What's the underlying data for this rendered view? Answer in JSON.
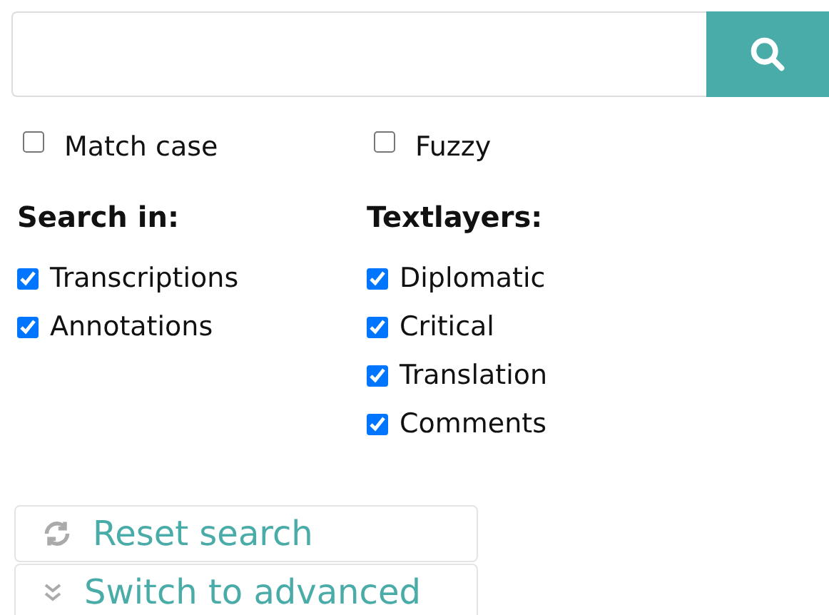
{
  "options": [
    {
      "label": "Match case",
      "checked": false
    },
    {
      "label": "Fuzzy",
      "checked": false
    }
  ],
  "groups": [
    {
      "title": "Search in:",
      "items": [
        {
          "label": "Transcriptions",
          "checked": true
        },
        {
          "label": "Annotations",
          "checked": true
        }
      ]
    },
    {
      "title": "Textlayers:",
      "items": [
        {
          "label": "Diplomatic",
          "checked": true
        },
        {
          "label": "Critical",
          "checked": true
        },
        {
          "label": "Translation",
          "checked": true
        },
        {
          "label": "Comments",
          "checked": true
        }
      ]
    }
  ],
  "actions": [
    {
      "label": "Reset search",
      "kind": "reset"
    },
    {
      "label": "Switch to advanced",
      "kind": "advanced"
    }
  ]
}
